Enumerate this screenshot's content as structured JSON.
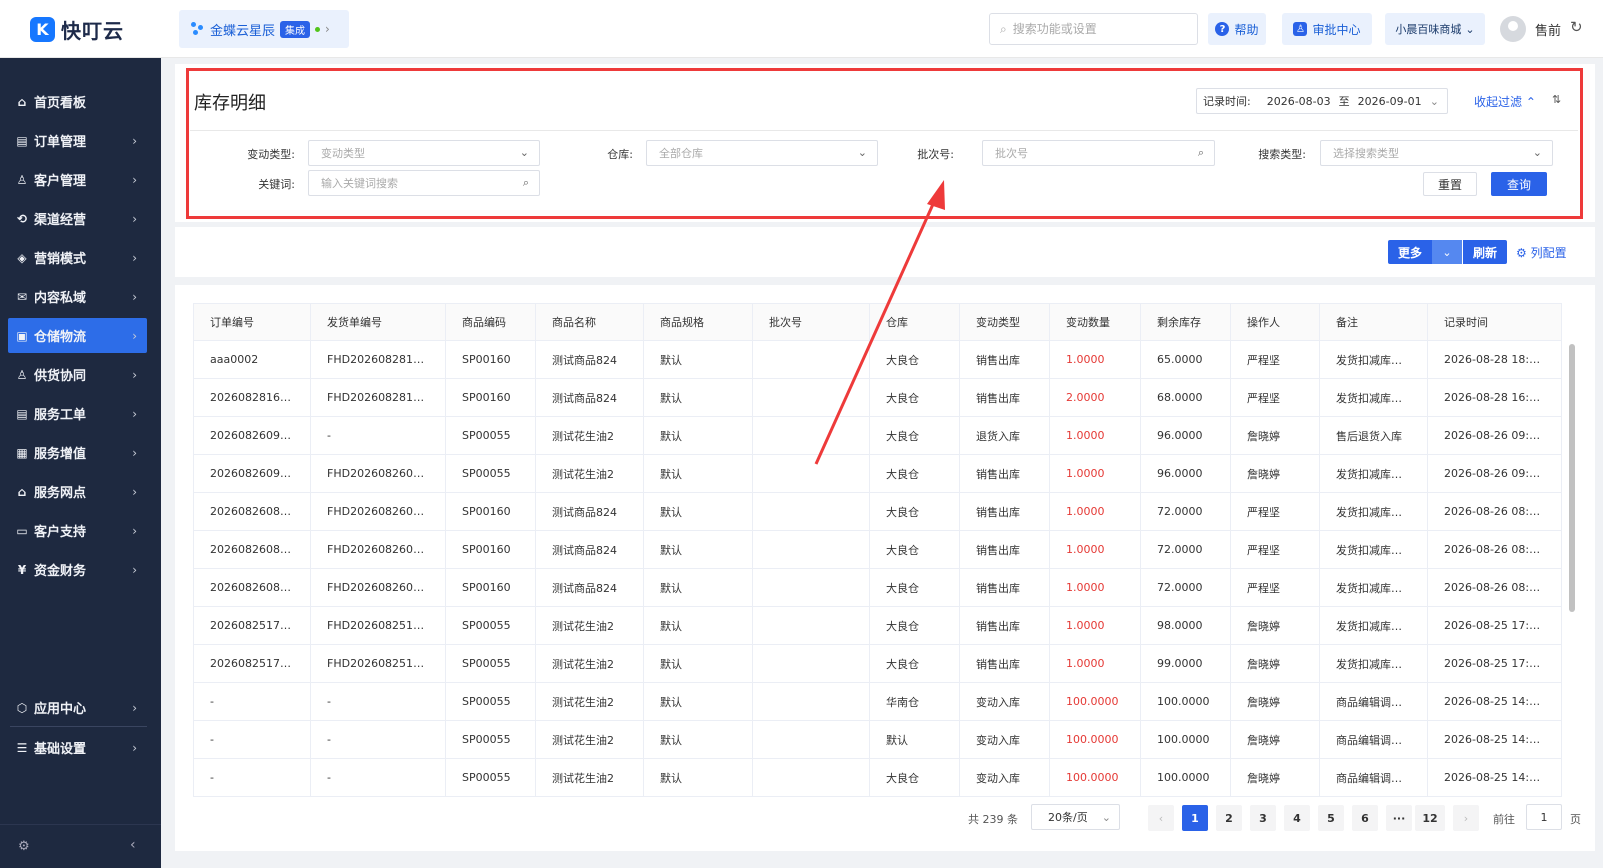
{
  "app": {
    "logo_mark": "K",
    "logo_text": "快叮云",
    "brand_name": "金蝶云星辰",
    "brand_tag": "集成",
    "brand_chevron": "›"
  },
  "header": {
    "search_placeholder": "搜索功能或设置",
    "help_label": "帮助",
    "approval_label": "审批中心",
    "store_label": "小晨百味商城",
    "user_name": "售前",
    "refresh_icon": "↻"
  },
  "sidebar": {
    "items": [
      {
        "label": "首页看板",
        "icon": "⌂",
        "has_chevron": false
      },
      {
        "label": "订单管理",
        "icon": "▤",
        "has_chevron": true
      },
      {
        "label": "客户管理",
        "icon": "♙",
        "has_chevron": true
      },
      {
        "label": "渠道经营",
        "icon": "⟲",
        "has_chevron": true
      },
      {
        "label": "营销模式",
        "icon": "◈",
        "has_chevron": true
      },
      {
        "label": "内容私域",
        "icon": "✉",
        "has_chevron": true
      },
      {
        "label": "仓储物流",
        "icon": "▣",
        "has_chevron": true,
        "active": true
      },
      {
        "label": "供货协同",
        "icon": "♙",
        "has_chevron": true
      },
      {
        "label": "服务工单",
        "icon": "▤",
        "has_chevron": true
      },
      {
        "label": "服务增值",
        "icon": "▦",
        "has_chevron": true
      },
      {
        "label": "服务网点",
        "icon": "⌂",
        "has_chevron": true
      },
      {
        "label": "客户支持",
        "icon": "▭",
        "has_chevron": true
      },
      {
        "label": "资金财务",
        "icon": "¥",
        "has_chevron": true
      }
    ],
    "bottom_items": [
      {
        "label": "应用中心",
        "icon": "⬡",
        "has_chevron": true
      },
      {
        "label": "基础设置",
        "icon": "☰",
        "has_chevron": true
      }
    ],
    "chevron": "›",
    "gear_icon": "⚙",
    "collapse_icon": "‹"
  },
  "filter": {
    "title": "库存明细",
    "record_time_label": "记录时间:",
    "date_start": "2026-08-03",
    "date_sep": "至",
    "date_end": "2026-09-01",
    "collapse_label": "收起过滤",
    "change_type_label": "变动类型:",
    "change_type_placeholder": "变动类型",
    "warehouse_label": "仓库:",
    "warehouse_placeholder": "全部仓库",
    "batch_label": "批次号:",
    "batch_placeholder": "批次号",
    "search_type_label": "搜索类型:",
    "search_type_placeholder": "选择搜索类型",
    "keyword_label": "关键词:",
    "keyword_placeholder": "输入关键词搜索",
    "reset_label": "重置",
    "query_label": "查询"
  },
  "actions": {
    "more_label": "更多",
    "refresh_label": "刷新",
    "column_config_label": "列配置"
  },
  "table": {
    "columns": [
      "订单编号",
      "发货单编号",
      "商品编码",
      "商品名称",
      "商品规格",
      "批次号",
      "仓库",
      "变动类型",
      "变动数量",
      "剩余库存",
      "操作人",
      "备注",
      "记录时间"
    ],
    "rows": [
      [
        "aaa0002",
        "FHD20260828180...",
        "SP00160",
        "测试商品824",
        "默认",
        "",
        "大良仓",
        "销售出库",
        "1.0000",
        "65.0000",
        "严程坚",
        "发货扣减库存...",
        "2026-08-28 18:05..."
      ],
      [
        "20260828161758...",
        "FHD20260828161...",
        "SP00160",
        "测试商品824",
        "默认",
        "",
        "大良仓",
        "销售出库",
        "2.0000",
        "68.0000",
        "严程坚",
        "发货扣减库存...",
        "2026-08-28 16:19..."
      ],
      [
        "20260826090455...",
        "-",
        "SP00055",
        "测试花生油2",
        "默认",
        "",
        "大良仓",
        "退货入库",
        "1.0000",
        "96.0000",
        "詹晓婷",
        "售后退货入库",
        "2026-08-26 09:13..."
      ],
      [
        "20260826090455...",
        "FHD20260826091...",
        "SP00055",
        "测试花生油2",
        "默认",
        "",
        "大良仓",
        "销售出库",
        "1.0000",
        "96.0000",
        "詹晓婷",
        "发货扣减库存...",
        "2026-08-26 09:12..."
      ],
      [
        "20260826083048...",
        "FHD20260826083...",
        "SP00160",
        "测试商品824",
        "默认",
        "",
        "大良仓",
        "销售出库",
        "1.0000",
        "72.0000",
        "严程坚",
        "发货扣减库存...",
        "2026-08-26 08:33..."
      ],
      [
        "20260826083048...",
        "FHD20260826083...",
        "SP00160",
        "测试商品824",
        "默认",
        "",
        "大良仓",
        "销售出库",
        "1.0000",
        "72.0000",
        "严程坚",
        "发货扣减库存...",
        "2026-08-26 08:33..."
      ],
      [
        "20260826083048...",
        "FHD20260826083...",
        "SP00160",
        "测试商品824",
        "默认",
        "",
        "大良仓",
        "销售出库",
        "1.0000",
        "72.0000",
        "严程坚",
        "发货扣减库存...",
        "2026-08-26 08:33..."
      ],
      [
        "20260825175756...",
        "FHD20260825175...",
        "SP00055",
        "测试花生油2",
        "默认",
        "",
        "大良仓",
        "销售出库",
        "1.0000",
        "98.0000",
        "詹晓婷",
        "发货扣减库存...",
        "2026-08-25 17:58..."
      ],
      [
        "20260825175445...",
        "FHD20260825175...",
        "SP00055",
        "测试花生油2",
        "默认",
        "",
        "大良仓",
        "销售出库",
        "1.0000",
        "99.0000",
        "詹晓婷",
        "发货扣减库存...",
        "2026-08-25 17:55..."
      ],
      [
        "-",
        "-",
        "SP00055",
        "测试花生油2",
        "默认",
        "",
        "华南仓",
        "变动入库",
        "100.0000",
        "100.0000",
        "詹晓婷",
        "商品编辑调整...",
        "2026-08-25 14:57..."
      ],
      [
        "-",
        "-",
        "SP00055",
        "测试花生油2",
        "默认",
        "",
        "默认",
        "变动入库",
        "100.0000",
        "100.0000",
        "詹晓婷",
        "商品编辑调整...",
        "2026-08-25 14:57..."
      ],
      [
        "-",
        "-",
        "SP00055",
        "测试花生油2",
        "默认",
        "",
        "大良仓",
        "变动入库",
        "100.0000",
        "100.0000",
        "詹晓婷",
        "商品编辑调整...",
        "2026-08-25 14:57..."
      ]
    ]
  },
  "pagination": {
    "total_label": "共 239 条",
    "page_size": "20条/页",
    "pages": [
      "1",
      "2",
      "3",
      "4",
      "5",
      "6",
      "···",
      "12"
    ],
    "current": "1",
    "prev": "‹",
    "next": "›",
    "goto_label": "前往",
    "goto_value": "1",
    "page_suffix": "页"
  },
  "colors": {
    "primary": "#2a62e8",
    "sidebar_bg": "#1e2940",
    "highlight_border": "#ee3a3a",
    "quantity_text": "#e53935"
  }
}
